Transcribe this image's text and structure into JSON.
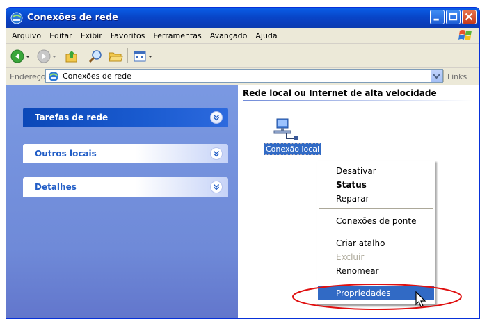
{
  "window": {
    "title": "Conexões de rede"
  },
  "menu": [
    "Arquivo",
    "Editar",
    "Exibir",
    "Favoritos",
    "Ferramentas",
    "Avançado",
    "Ajuda"
  ],
  "address": {
    "label": "Endereço",
    "value": "Conexões de rede",
    "links": "Links"
  },
  "left_panels": [
    {
      "title": "Tarefas de rede",
      "state": "active"
    },
    {
      "title": "Outros locais"
    },
    {
      "title": "Detalhes"
    }
  ],
  "group": {
    "title": "Rede local ou Internet de alta velocidade"
  },
  "connection": {
    "label": "Conexão local"
  },
  "context_menu": {
    "items": [
      {
        "label": "Desativar"
      },
      {
        "label": "Status",
        "style": "bold"
      },
      {
        "label": "Reparar"
      },
      {
        "label": "Conexões de ponte"
      },
      {
        "label": "Criar atalho"
      },
      {
        "label": "Excluir",
        "state": "disabled"
      },
      {
        "label": "Renomear"
      },
      {
        "label": "Propriedades",
        "state": "selected"
      }
    ]
  },
  "colors": {
    "titlebar": "#0a4fd6",
    "selection": "#316ac5",
    "highlight_ellipse": "#e01010",
    "task_pane": "#7a99e2"
  }
}
